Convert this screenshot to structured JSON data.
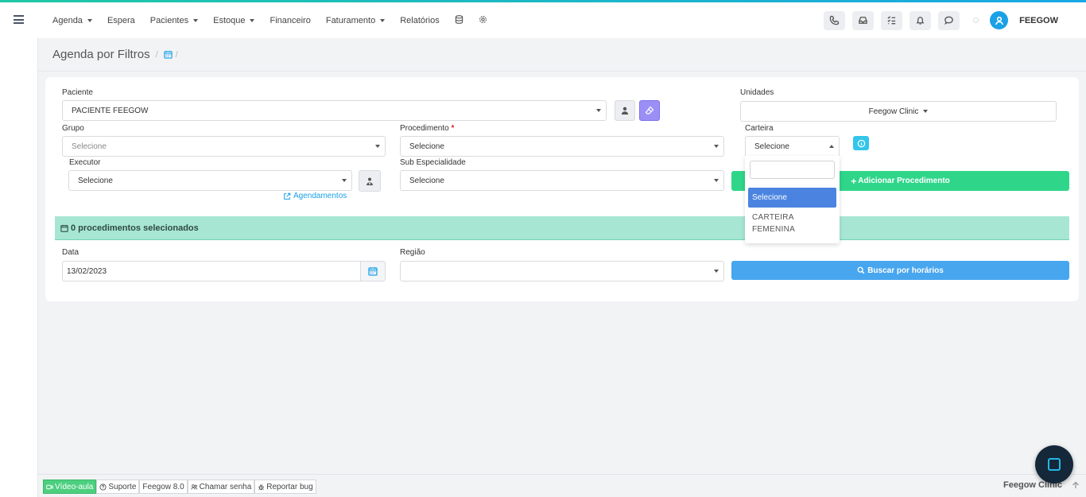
{
  "header": {
    "nav": [
      {
        "label": "Agenda",
        "has_caret": true
      },
      {
        "label": "Espera",
        "has_caret": false
      },
      {
        "label": "Pacientes",
        "has_caret": true
      },
      {
        "label": "Estoque",
        "has_caret": true
      },
      {
        "label": "Financeiro",
        "has_caret": false
      },
      {
        "label": "Faturamento",
        "has_caret": true
      },
      {
        "label": "Relatórios",
        "has_caret": false
      }
    ],
    "right_icons": [
      "phone-icon",
      "inbox-icon",
      "tasks-icon",
      "bell-icon",
      "chat-icon"
    ],
    "username": "FEEGOW"
  },
  "breadcrumb": {
    "title": "Agenda por Filtros",
    "sep1": "/",
    "sep2": "/"
  },
  "form": {
    "paciente": {
      "label": "Paciente",
      "value": "PACIENTE FEEGOW"
    },
    "unidades": {
      "label": "Unidades",
      "value": "Feegow Clinic"
    },
    "grupo": {
      "label": "Grupo",
      "placeholder": "Selecione"
    },
    "procedimento": {
      "label": "Procedimento",
      "required_mark": "*",
      "value": "Selecione"
    },
    "carteira": {
      "label": "Carteira",
      "value": "Selecione"
    },
    "executor": {
      "label": "Executor",
      "value": "Selecione"
    },
    "sub_especialidade": {
      "label": "Sub Especialidade",
      "value": "Selecione"
    },
    "agendamentos_link": "Agendamentos",
    "add_procedimento": "Adicionar Procedimento",
    "procedimentos_bar": "0 procedimentos selecionados",
    "data": {
      "label": "Data",
      "value": "13/02/2023"
    },
    "regiao": {
      "label": "Região",
      "value": ""
    },
    "buscar": "Buscar por horários"
  },
  "carteira_dropdown": {
    "search_value": "",
    "options": [
      "Selecione",
      "CARTEIRA FEMENINA"
    ],
    "selected": "Selecione"
  },
  "footer": {
    "items": [
      {
        "label": "Vídeo-aula",
        "icon": "video-icon"
      },
      {
        "label": "Suporte",
        "icon": "help-icon"
      },
      {
        "label": "Feegow 8.0",
        "icon": ""
      },
      {
        "label": "Chamar senha",
        "icon": "users-icon"
      },
      {
        "label": "Reportar bug",
        "icon": "bug-icon"
      }
    ],
    "clinic": "Feegow Clinic"
  },
  "colors": {
    "accent_green": "#2fd68a",
    "accent_blue": "#48a6ef",
    "proc_bar": "#a7e6d3",
    "purple": "#9b8ff5"
  }
}
